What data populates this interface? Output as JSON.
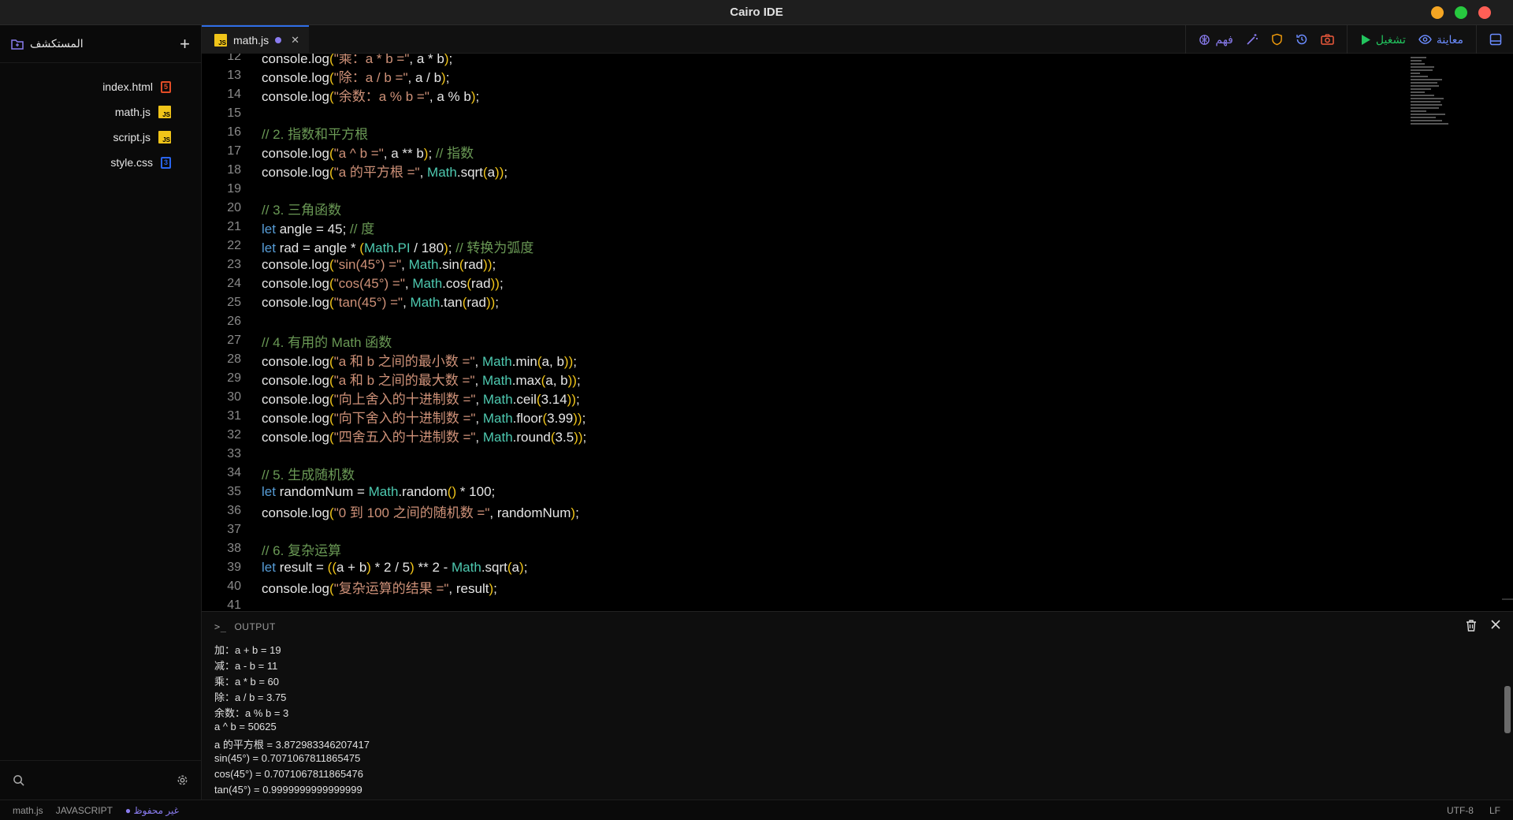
{
  "window": {
    "title": "Cairo IDE",
    "controls": {
      "minimize_color": "#f5a623",
      "maximize_color": "#27c93f",
      "close_color": "#ff5f56"
    }
  },
  "sidebar": {
    "title": "المستكشف",
    "files": [
      {
        "name": "index.html",
        "type": "html"
      },
      {
        "name": "math.js",
        "type": "js"
      },
      {
        "name": "script.js",
        "type": "js"
      },
      {
        "name": "style.css",
        "type": "css"
      }
    ]
  },
  "tab": {
    "label": "math.js",
    "icon_text": "JS"
  },
  "toolbar": {
    "understand_label": "فهم",
    "run_label": "تشغيل",
    "preview_label": "معاينة"
  },
  "editor": {
    "lines": [
      {
        "n": "12",
        "t": "console.log(\"乘：a * b =\", a * b);"
      },
      {
        "n": "13",
        "t": "console.log(\"除：a / b =\", a / b);"
      },
      {
        "n": "14",
        "t": "console.log(\"余数：a % b =\", a % b);"
      },
      {
        "n": "15",
        "t": ""
      },
      {
        "n": "16",
        "t": "// 2. 指数和平方根"
      },
      {
        "n": "17",
        "t": "console.log(\"a ^ b =\", a ** b); // 指数"
      },
      {
        "n": "18",
        "t": "console.log(\"a 的平方根 =\", Math.sqrt(a));"
      },
      {
        "n": "19",
        "t": ""
      },
      {
        "n": "20",
        "t": "// 3. 三角函数"
      },
      {
        "n": "21",
        "t": "let angle = 45; // 度"
      },
      {
        "n": "22",
        "t": "let rad = angle * (Math.PI / 180); // 转换为弧度"
      },
      {
        "n": "23",
        "t": "console.log(\"sin(45°) =\", Math.sin(rad));"
      },
      {
        "n": "24",
        "t": "console.log(\"cos(45°) =\", Math.cos(rad));"
      },
      {
        "n": "25",
        "t": "console.log(\"tan(45°) =\", Math.tan(rad));"
      },
      {
        "n": "26",
        "t": ""
      },
      {
        "n": "27",
        "t": "// 4. 有用的 Math 函数"
      },
      {
        "n": "28",
        "t": "console.log(\"a 和 b 之间的最小数 =\", Math.min(a, b));"
      },
      {
        "n": "29",
        "t": "console.log(\"a 和 b 之间的最大数 =\", Math.max(a, b));"
      },
      {
        "n": "30",
        "t": "console.log(\"向上舍入的十进制数 =\", Math.ceil(3.14));"
      },
      {
        "n": "31",
        "t": "console.log(\"向下舍入的十进制数 =\", Math.floor(3.99));"
      },
      {
        "n": "32",
        "t": "console.log(\"四舍五入的十进制数 =\", Math.round(3.5));"
      },
      {
        "n": "33",
        "t": ""
      },
      {
        "n": "34",
        "t": "// 5. 生成随机数"
      },
      {
        "n": "35",
        "t": "let randomNum = Math.random() * 100;"
      },
      {
        "n": "36",
        "t": "console.log(\"0 到 100 之间的随机数 =\", randomNum);"
      },
      {
        "n": "37",
        "t": ""
      },
      {
        "n": "38",
        "t": "// 6. 复杂运算"
      },
      {
        "n": "39",
        "t": "let result = ((a + b) * 2 / 5) ** 2 - Math.sqrt(a);"
      },
      {
        "n": "40",
        "t": "console.log(\"复杂运算的结果 =\", result);"
      },
      {
        "n": "41",
        "t": ""
      }
    ]
  },
  "output": {
    "title": "OUTPUT",
    "lines": [
      "加：a + b = 19",
      "减：a - b = 11",
      "乘：a * b = 60",
      "除：a / b = 3.75",
      "余数：a % b = 3",
      "a ^ b = 50625",
      "a 的平方根 = 3.872983346207417",
      "sin(45°) = 0.7071067811865475",
      "cos(45°) = 0.7071067811865476",
      "tan(45°) = 0.9999999999999999"
    ]
  },
  "status": {
    "file": "math.js",
    "language": "JAVASCRIPT",
    "unsaved": "غير محفوظ",
    "encoding": "UTF-8",
    "eol": "LF"
  }
}
